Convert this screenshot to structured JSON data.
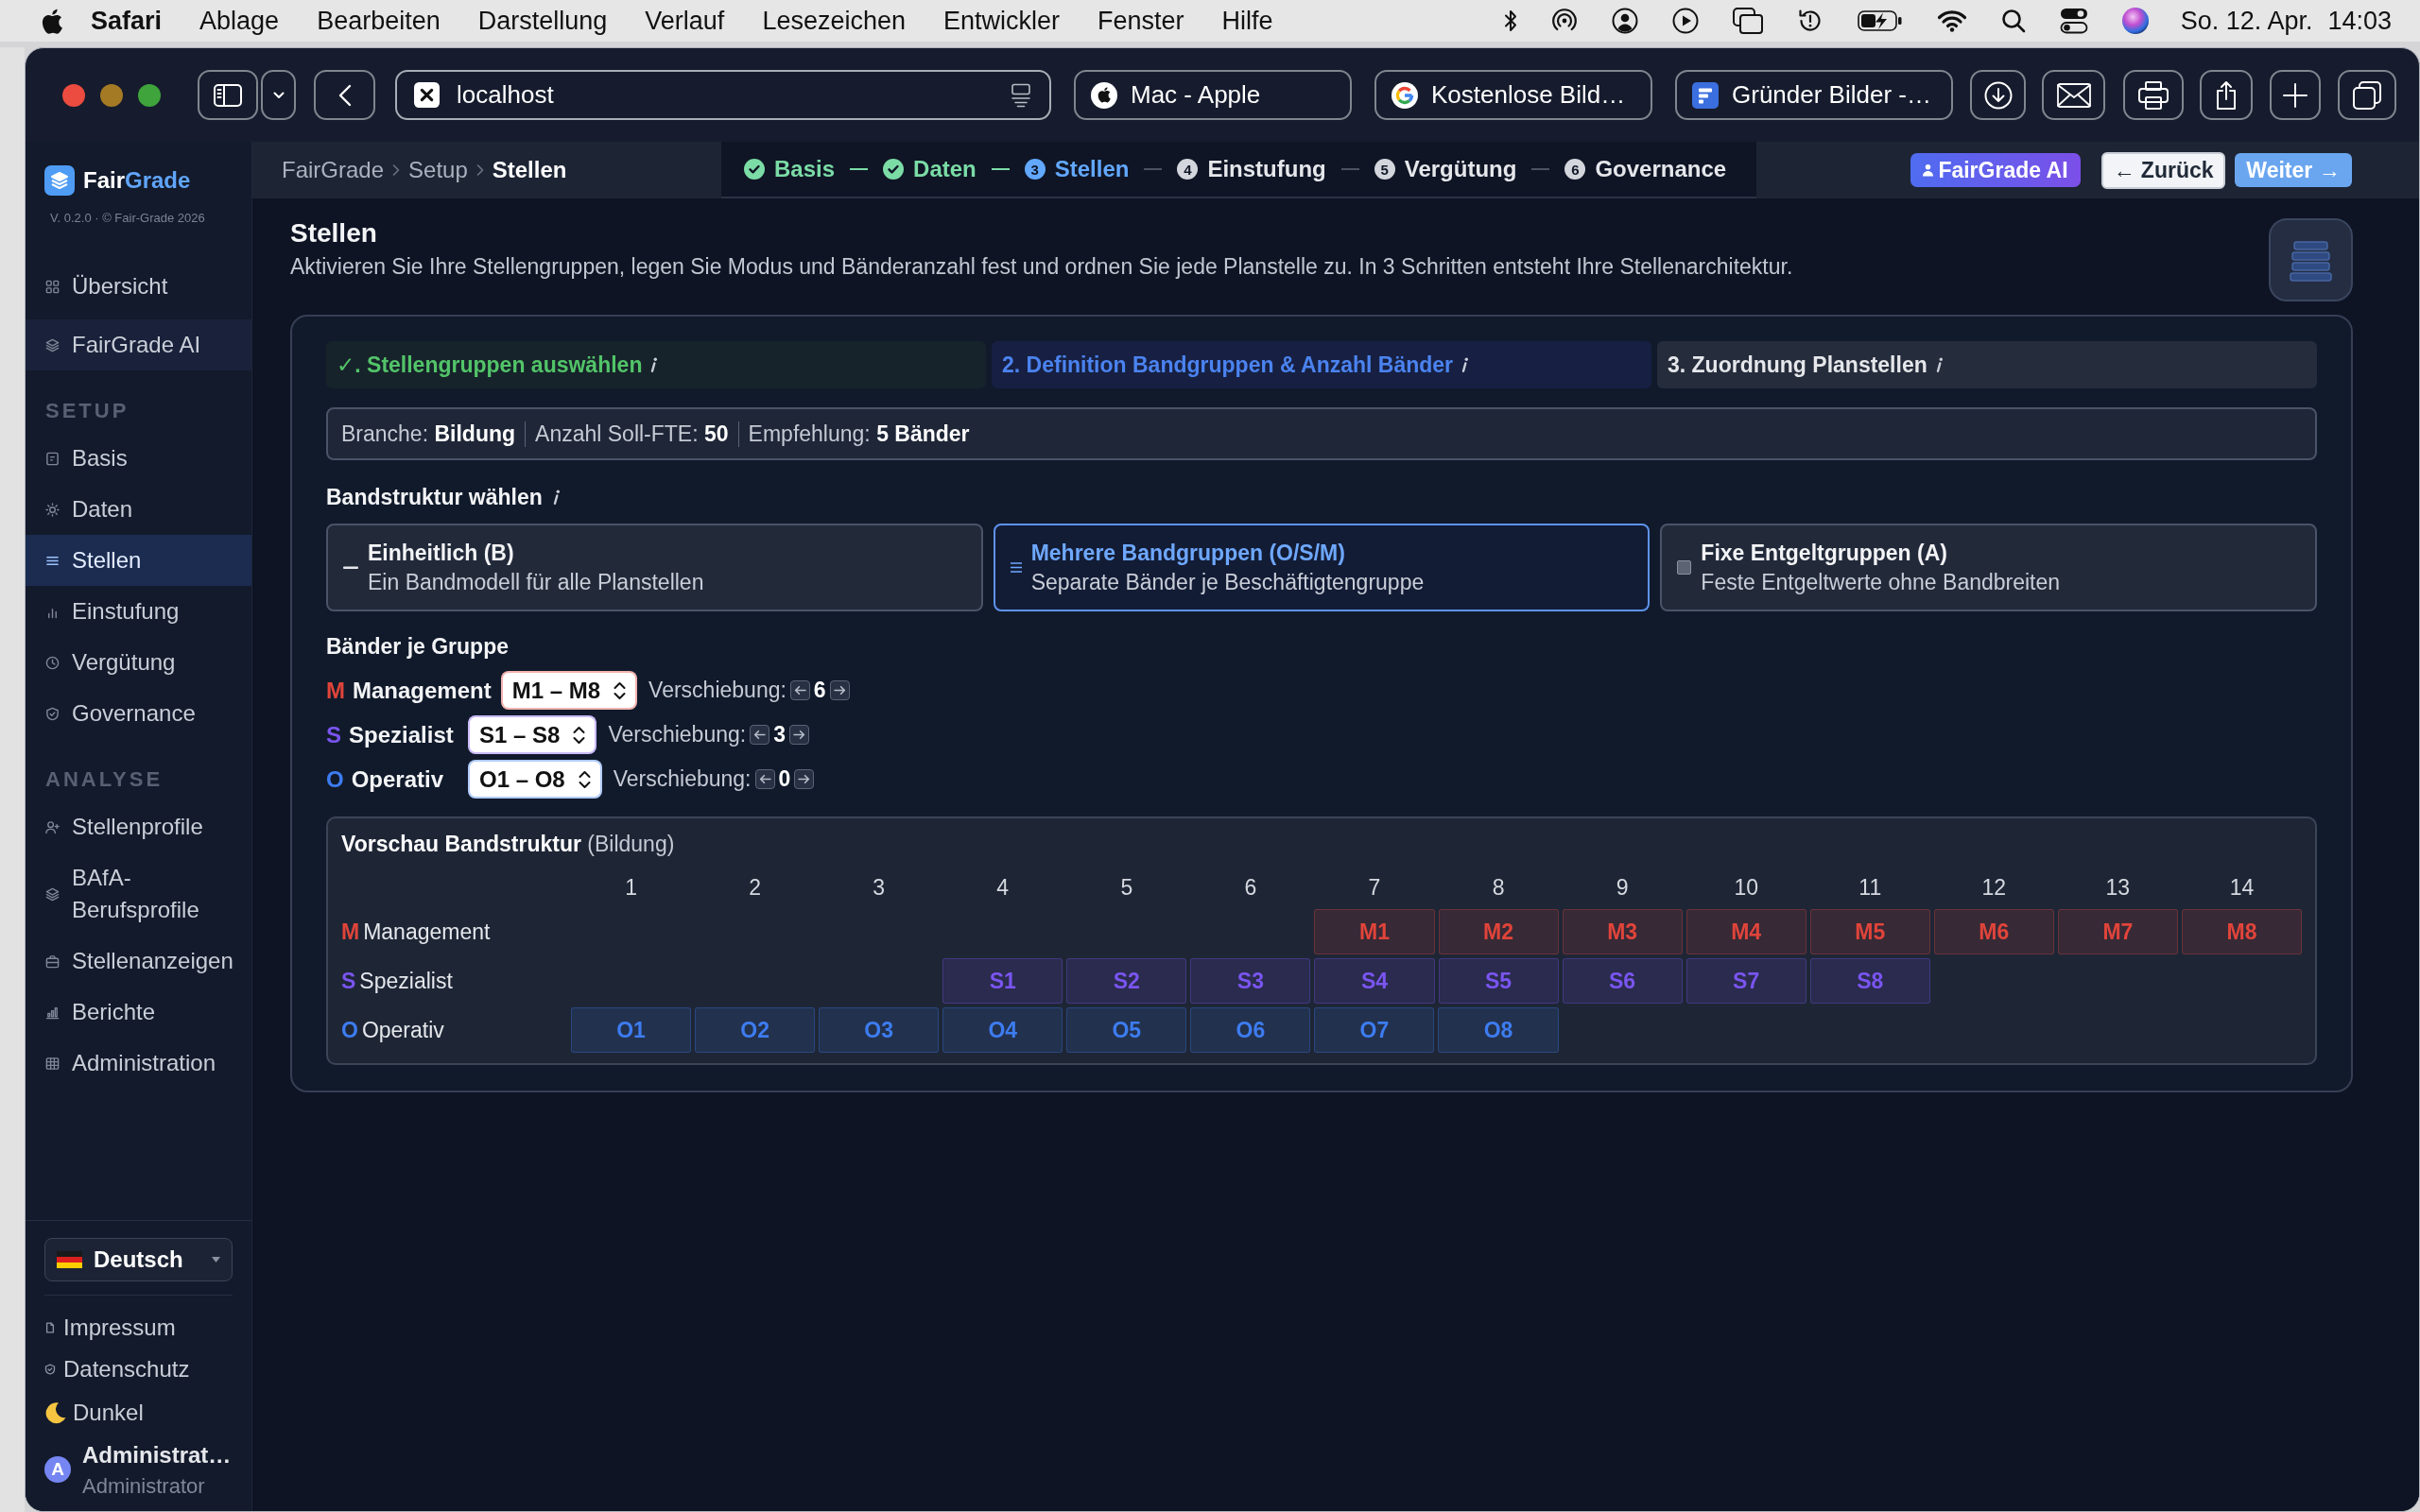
{
  "menu_bar": {
    "app": "Safari",
    "items": [
      "Ablage",
      "Bearbeiten",
      "Darstellung",
      "Verlauf",
      "Lesezeichen",
      "Entwickler",
      "Fenster",
      "Hilfe"
    ],
    "date": "So. 12. Apr.",
    "time": "14:03"
  },
  "browser": {
    "address": "localhost",
    "tabs": [
      {
        "title": "Mac - Apple"
      },
      {
        "title": "Kostenlose Bild…"
      },
      {
        "title": "Gründer Bilder -…"
      }
    ]
  },
  "sidebar": {
    "logo": {
      "first": "Fair",
      "second": "Grade"
    },
    "version": "V. 0.2.0 · © Fair-Grade 2026",
    "items": [
      {
        "label": "Übersicht",
        "selected": false,
        "highlighted": false
      },
      {
        "label": "FairGrade AI",
        "selected": false,
        "highlighted": true
      }
    ],
    "sections": [
      {
        "title": "SETUP",
        "items": [
          {
            "label": "Basis",
            "selected": false
          },
          {
            "label": "Daten",
            "selected": false
          },
          {
            "label": "Stellen",
            "selected": true
          },
          {
            "label": "Einstufung",
            "selected": false
          },
          {
            "label": "Vergütung",
            "selected": false
          },
          {
            "label": "Governance",
            "selected": false
          }
        ]
      },
      {
        "title": "ANALYSE",
        "items": [
          {
            "label": "Stellenprofile",
            "selected": false
          },
          {
            "label": "BAfA-Berufsprofile",
            "selected": false
          },
          {
            "label": "Stellenanzeigen",
            "selected": false
          },
          {
            "label": "Berichte",
            "selected": false
          },
          {
            "label": "Administration",
            "selected": false
          }
        ]
      }
    ],
    "language": "Deutsch",
    "links": [
      "Impressum",
      "Datenschutz"
    ],
    "theme": "Dunkel",
    "user": {
      "initial": "A",
      "name": "Administrat…",
      "role": "Administrator"
    }
  },
  "header": {
    "breadcrumb": [
      "FairGrade",
      "Setup",
      "Stellen"
    ],
    "steps": [
      {
        "label": "Basis",
        "done": true,
        "selected": false
      },
      {
        "label": "Daten",
        "done": true,
        "selected": false
      },
      {
        "number": "3",
        "label": "Stellen",
        "done": false,
        "selected": true
      },
      {
        "number": "4",
        "label": "Einstufung",
        "done": false,
        "selected": false
      },
      {
        "number": "5",
        "label": "Vergütung",
        "done": false,
        "selected": false
      },
      {
        "number": "6",
        "label": "Governance",
        "done": false,
        "selected": false
      }
    ],
    "ai_button": "FairGrade AI",
    "back_button": "← Zurück",
    "next_button": "Weiter →"
  },
  "page": {
    "title": "Stellen",
    "description": "Aktivieren Sie Ihre Stellengruppen, legen Sie Modus und Bänderanzahl fest und ordnen Sie jede Planstelle zu. In 3 Schritten entsteht Ihre Stellenarchitektur."
  },
  "wizard": {
    "tabs": [
      {
        "label": "✓. Stellengruppen auswählen",
        "done": true,
        "selected": false
      },
      {
        "label": "2. Definition Bandgruppen & Anzahl Bänder",
        "done": false,
        "selected": true
      },
      {
        "label": "3. Zuordnung Planstellen",
        "done": false,
        "selected": false
      }
    ],
    "facts": [
      "Branche: **Bildung**",
      "Anzahl Soll-FTE: **50**",
      "Empfehlung: **5 Bänder**"
    ],
    "structure_heading": "Bandstruktur wählen",
    "structure_options": [
      {
        "title": "Einheitlich (B)",
        "description": "Ein Bandmodell für alle Planstellen",
        "selected": false
      },
      {
        "title": "Mehrere Bandgruppen (O/S/M)",
        "description": "Separate Bänder je Beschäftigtengruppe",
        "selected": true
      },
      {
        "title": "Fixe Entgeltgruppen (A)",
        "description": "Feste Entgeltwerte ohne Bandbreiten",
        "selected": false
      }
    ],
    "groups_heading": "Bänder je Gruppe",
    "groups": [
      {
        "letter": "M",
        "name": "Management",
        "color": "#e0443a",
        "range": "M1 – M8",
        "shift_label": "Verschiebung:",
        "shift": "6"
      },
      {
        "letter": "S",
        "name": "Spezialist",
        "color": "#7a55f0",
        "range": "S1 – S8",
        "shift_label": "Verschiebung:",
        "shift": "3"
      },
      {
        "letter": "O",
        "name": "Operativ",
        "color": "#3d7cf0",
        "range": "O1 – O8",
        "shift_label": "Verschiebung:",
        "shift": "0"
      }
    ],
    "preview": {
      "title": "**Vorschau Bandstruktur** (Bildung)",
      "columns": [
        "1",
        "2",
        "3",
        "4",
        "5",
        "6",
        "7",
        "8",
        "9",
        "10",
        "11",
        "12",
        "13",
        "14"
      ],
      "rows": [
        {
          "letter": "M",
          "name": "Management",
          "bands": [
            "M1",
            "M2",
            "M3",
            "M4",
            "M5",
            "M6",
            "M7",
            "M8"
          ]
        },
        {
          "letter": "S",
          "name": "Spezialist",
          "bands": [
            "S1",
            "S2",
            "S3",
            "S4",
            "S5",
            "S6",
            "S7",
            "S8"
          ]
        },
        {
          "letter": "O",
          "name": "Operativ",
          "bands": [
            "O1",
            "O2",
            "O3",
            "O4",
            "O5",
            "O6",
            "O7",
            "O8"
          ]
        }
      ]
    }
  }
}
